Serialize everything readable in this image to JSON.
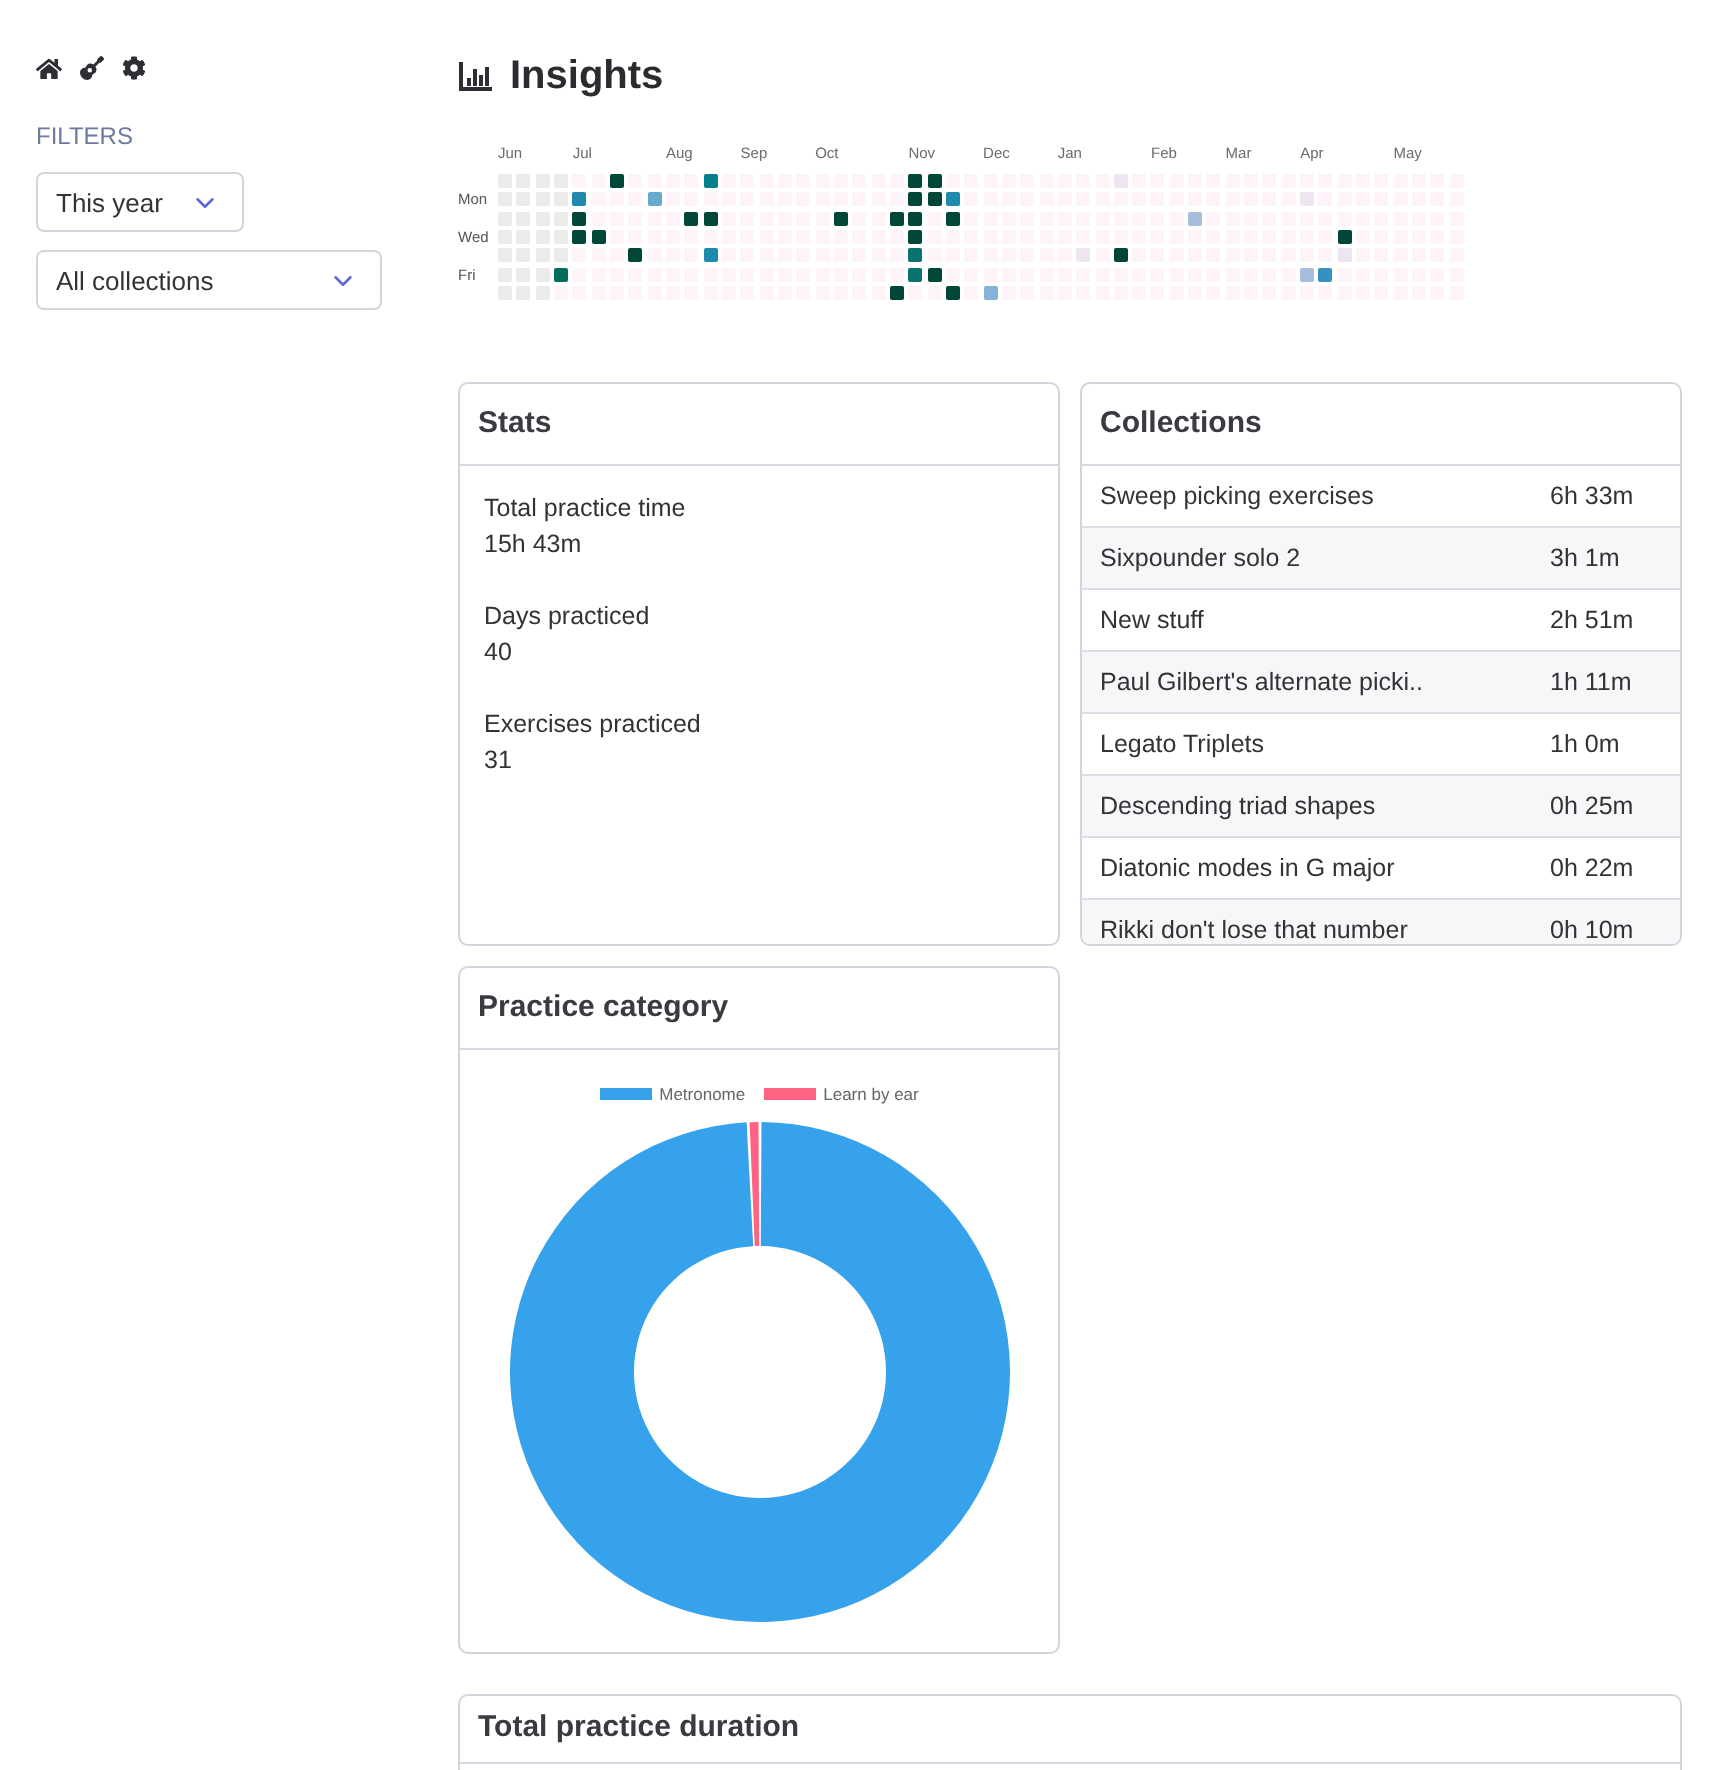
{
  "sidebar": {
    "filters_label": "FILTERS",
    "filters": [
      {
        "value": "This year"
      },
      {
        "value": "All collections"
      }
    ]
  },
  "page_title": "Insights",
  "heatmap": {
    "weekday_labels": [
      "Mon",
      "Wed",
      "Fri"
    ],
    "weeks": [
      {
        "month": "Jun",
        "days": [
          {
            "color": "#ebebeb"
          },
          {
            "color": "#ebebeb"
          },
          {
            "color": "#ebebeb"
          },
          {
            "color": "#ebebeb"
          },
          {
            "color": "#ebebeb"
          },
          {
            "color": "#ebebeb"
          },
          {
            "color": "#ebebeb"
          }
        ]
      },
      {
        "days": [
          {
            "color": "#ebebeb"
          },
          {
            "color": "#ebebeb"
          },
          {
            "color": "#ebebeb"
          },
          {
            "color": "#ebebeb"
          },
          {
            "color": "#ebebeb"
          },
          {
            "color": "#ebebeb"
          },
          {
            "color": "#ebebeb"
          }
        ]
      },
      {
        "days": [
          {
            "color": "#ebebeb"
          },
          {
            "color": "#ebebeb"
          },
          {
            "color": "#ebebeb"
          },
          {
            "color": "#ebebeb"
          },
          {
            "color": "#ebebeb"
          },
          {
            "color": "#ebebeb"
          },
          {
            "color": "#ebebeb"
          }
        ]
      },
      {
        "days": [
          {
            "color": "#ebebeb"
          },
          {
            "color": "#ebebeb"
          },
          {
            "color": "#ebebeb"
          },
          {
            "color": "#ebebeb"
          },
          {
            "color": "#ebebeb"
          },
          {
            "color": "#016c59"
          },
          {
            "color": "#fdf3f8"
          }
        ]
      },
      {
        "month": "Jul",
        "days": [
          {
            "color": "#fdf3f8"
          },
          {
            "color": "#1f8aab"
          },
          {
            "color": "#014636"
          },
          {
            "color": "#014636"
          },
          {
            "color": "#fdf3f8"
          },
          {
            "color": "#fdf3f8"
          },
          {
            "color": "#fdf3f8"
          }
        ]
      },
      {
        "days": [
          {
            "color": "#fdf3f8"
          },
          {
            "color": "#fdf3f8"
          },
          {
            "color": "#fdf3f8"
          },
          {
            "color": "#014636"
          },
          {
            "color": "#fdf3f8"
          },
          {
            "color": "#fdf3f8"
          },
          {
            "color": "#fdf3f8"
          }
        ]
      },
      {
        "days": [
          {
            "color": "#014636"
          },
          {
            "color": "#fdf3f8"
          },
          {
            "color": "#fdf3f8"
          },
          {
            "color": "#fdf3f8"
          },
          {
            "color": "#fdf3f8"
          },
          {
            "color": "#fdf3f8"
          },
          {
            "color": "#fdf3f8"
          }
        ]
      },
      {
        "days": [
          {
            "color": "#fdf3f8"
          },
          {
            "color": "#fdf3f8"
          },
          {
            "color": "#fdf3f8"
          },
          {
            "color": "#fdf3f8"
          },
          {
            "color": "#014636"
          },
          {
            "color": "#fdf3f8"
          },
          {
            "color": "#fdf3f8"
          }
        ]
      },
      {
        "days": [
          {
            "color": "#fdf3f8"
          },
          {
            "color": "#67a9cf"
          },
          {
            "color": "#fdf3f8"
          },
          {
            "color": "#fdf3f8"
          },
          {
            "color": "#fdf3f8"
          },
          {
            "color": "#fdf3f8"
          },
          {
            "color": "#fdf3f8"
          }
        ]
      },
      {
        "month": "Aug",
        "days": [
          {
            "color": "#fdf3f8"
          },
          {
            "color": "#fdf3f8"
          },
          {
            "color": "#fdf3f8"
          },
          {
            "color": "#fdf3f8"
          },
          {
            "color": "#fdf3f8"
          },
          {
            "color": "#fdf3f8"
          },
          {
            "color": "#fdf3f8"
          }
        ]
      },
      {
        "days": [
          {
            "color": "#fdf3f8"
          },
          {
            "color": "#fdf3f8"
          },
          {
            "color": "#014636"
          },
          {
            "color": "#fdf3f8"
          },
          {
            "color": "#fdf3f8"
          },
          {
            "color": "#fdf3f8"
          },
          {
            "color": "#fdf3f8"
          }
        ]
      },
      {
        "days": [
          {
            "color": "#02818a"
          },
          {
            "color": "#fdf3f8"
          },
          {
            "color": "#014636"
          },
          {
            "color": "#fdf3f8"
          },
          {
            "color": "#1f8aab"
          },
          {
            "color": "#fdf3f8"
          },
          {
            "color": "#fdf3f8"
          }
        ]
      },
      {
        "days": [
          {
            "color": "#fdf3f8"
          },
          {
            "color": "#fdf3f8"
          },
          {
            "color": "#fdf3f8"
          },
          {
            "color": "#fdf3f8"
          },
          {
            "color": "#fdf3f8"
          },
          {
            "color": "#fdf3f8"
          },
          {
            "color": "#fdf3f8"
          }
        ]
      },
      {
        "month": "Sep",
        "days": [
          {
            "color": "#fdf3f8"
          },
          {
            "color": "#fdf3f8"
          },
          {
            "color": "#fdf3f8"
          },
          {
            "color": "#fdf3f8"
          },
          {
            "color": "#fdf3f8"
          },
          {
            "color": "#fdf3f8"
          },
          {
            "color": "#fdf3f8"
          }
        ]
      },
      {
        "days": [
          {
            "color": "#fdf3f8"
          },
          {
            "color": "#fdf3f8"
          },
          {
            "color": "#fdf3f8"
          },
          {
            "color": "#fdf3f8"
          },
          {
            "color": "#fdf3f8"
          },
          {
            "color": "#fdf3f8"
          },
          {
            "color": "#fdf3f8"
          }
        ]
      },
      {
        "days": [
          {
            "color": "#fdf3f8"
          },
          {
            "color": "#fdf3f8"
          },
          {
            "color": "#fdf3f8"
          },
          {
            "color": "#fdf3f8"
          },
          {
            "color": "#fdf3f8"
          },
          {
            "color": "#fdf3f8"
          },
          {
            "color": "#fdf3f8"
          }
        ]
      },
      {
        "days": [
          {
            "color": "#fdf3f8"
          },
          {
            "color": "#fdf3f8"
          },
          {
            "color": "#fdf3f8"
          },
          {
            "color": "#fdf3f8"
          },
          {
            "color": "#fdf3f8"
          },
          {
            "color": "#fdf3f8"
          },
          {
            "color": "#fdf3f8"
          }
        ]
      },
      {
        "month": "Oct",
        "days": [
          {
            "color": "#fdf3f8"
          },
          {
            "color": "#fdf3f8"
          },
          {
            "color": "#fdf3f8"
          },
          {
            "color": "#fdf3f8"
          },
          {
            "color": "#fdf3f8"
          },
          {
            "color": "#fdf3f8"
          },
          {
            "color": "#fdf3f8"
          }
        ]
      },
      {
        "days": [
          {
            "color": "#fdf3f8"
          },
          {
            "color": "#fdf3f8"
          },
          {
            "color": "#014636"
          },
          {
            "color": "#fdf3f8"
          },
          {
            "color": "#fdf3f8"
          },
          {
            "color": "#fdf3f8"
          },
          {
            "color": "#fdf3f8"
          }
        ]
      },
      {
        "days": [
          {
            "color": "#fdf3f8"
          },
          {
            "color": "#fdf3f8"
          },
          {
            "color": "#fdf3f8"
          },
          {
            "color": "#fdf3f8"
          },
          {
            "color": "#fdf3f8"
          },
          {
            "color": "#fdf3f8"
          },
          {
            "color": "#fdf3f8"
          }
        ]
      },
      {
        "days": [
          {
            "color": "#fdf3f8"
          },
          {
            "color": "#fdf3f8"
          },
          {
            "color": "#fdf3f8"
          },
          {
            "color": "#fdf3f8"
          },
          {
            "color": "#fdf3f8"
          },
          {
            "color": "#fdf3f8"
          },
          {
            "color": "#fdf3f8"
          }
        ]
      },
      {
        "days": [
          {
            "color": "#fdf3f8"
          },
          {
            "color": "#fdf3f8"
          },
          {
            "color": "#014636"
          },
          {
            "color": "#fdf3f8"
          },
          {
            "color": "#fdf3f8"
          },
          {
            "color": "#fdf3f8"
          },
          {
            "color": "#014636"
          }
        ]
      },
      {
        "month": "Nov",
        "days": [
          {
            "color": "#014636"
          },
          {
            "color": "#014636"
          },
          {
            "color": "#014636"
          },
          {
            "color": "#014636"
          },
          {
            "color": "#0a7370"
          },
          {
            "color": "#0a7370"
          },
          {
            "color": "#fdf3f8"
          }
        ]
      },
      {
        "days": [
          {
            "color": "#014636"
          },
          {
            "color": "#014636"
          },
          {
            "color": "#fdf3f8"
          },
          {
            "color": "#fdf3f8"
          },
          {
            "color": "#fdf3f8"
          },
          {
            "color": "#014636"
          },
          {
            "color": "#fdf3f8"
          }
        ]
      },
      {
        "days": [
          {
            "color": "#fdf3f8"
          },
          {
            "color": "#1f8aab"
          },
          {
            "color": "#014636"
          },
          {
            "color": "#fdf3f8"
          },
          {
            "color": "#fdf3f8"
          },
          {
            "color": "#fdf3f8"
          },
          {
            "color": "#014636"
          }
        ]
      },
      {
        "days": [
          {
            "color": "#fdf3f8"
          },
          {
            "color": "#fdf3f8"
          },
          {
            "color": "#fdf3f8"
          },
          {
            "color": "#fdf3f8"
          },
          {
            "color": "#fdf3f8"
          },
          {
            "color": "#fdf3f8"
          },
          {
            "color": "#fdf3f8"
          }
        ]
      },
      {
        "month": "Dec",
        "days": [
          {
            "color": "#fdf3f8"
          },
          {
            "color": "#fdf3f8"
          },
          {
            "color": "#fdf3f8"
          },
          {
            "color": "#fdf3f8"
          },
          {
            "color": "#fdf3f8"
          },
          {
            "color": "#fdf3f8"
          },
          {
            "color": "#86b1d8"
          }
        ]
      },
      {
        "days": [
          {
            "color": "#fdf3f8"
          },
          {
            "color": "#fdf3f8"
          },
          {
            "color": "#fdf3f8"
          },
          {
            "color": "#fdf3f8"
          },
          {
            "color": "#fdf3f8"
          },
          {
            "color": "#fdf3f8"
          },
          {
            "color": "#fdf3f8"
          }
        ]
      },
      {
        "days": [
          {
            "color": "#fdf3f8"
          },
          {
            "color": "#fdf3f8"
          },
          {
            "color": "#fdf3f8"
          },
          {
            "color": "#fdf3f8"
          },
          {
            "color": "#fdf3f8"
          },
          {
            "color": "#fdf3f8"
          },
          {
            "color": "#fdf3f8"
          }
        ]
      },
      {
        "days": [
          {
            "color": "#fdf3f8"
          },
          {
            "color": "#fdf3f8"
          },
          {
            "color": "#fdf3f8"
          },
          {
            "color": "#fdf3f8"
          },
          {
            "color": "#fdf3f8"
          },
          {
            "color": "#fdf3f8"
          },
          {
            "color": "#fdf3f8"
          }
        ]
      },
      {
        "month": "Jan",
        "days": [
          {
            "color": "#fdf3f8"
          },
          {
            "color": "#fdf3f8"
          },
          {
            "color": "#fdf3f8"
          },
          {
            "color": "#fdf3f8"
          },
          {
            "color": "#fdf3f8"
          },
          {
            "color": "#fdf3f8"
          },
          {
            "color": "#fdf3f8"
          }
        ]
      },
      {
        "days": [
          {
            "color": "#fdf3f8"
          },
          {
            "color": "#fdf3f8"
          },
          {
            "color": "#fdf3f8"
          },
          {
            "color": "#fdf3f8"
          },
          {
            "color": "#efe5f1"
          },
          {
            "color": "#fdf3f8"
          },
          {
            "color": "#fdf3f8"
          }
        ]
      },
      {
        "days": [
          {
            "color": "#fdf3f8"
          },
          {
            "color": "#fdf3f8"
          },
          {
            "color": "#fdf3f8"
          },
          {
            "color": "#fdf3f8"
          },
          {
            "color": "#fdf3f8"
          },
          {
            "color": "#fdf3f8"
          },
          {
            "color": "#fdf3f8"
          }
        ]
      },
      {
        "days": [
          {
            "color": "#efe5f1"
          },
          {
            "color": "#fdf3f8"
          },
          {
            "color": "#fdf3f8"
          },
          {
            "color": "#fdf3f8"
          },
          {
            "color": "#014636"
          },
          {
            "color": "#fdf3f8"
          },
          {
            "color": "#fdf3f8"
          }
        ]
      },
      {
        "days": [
          {
            "color": "#fdf3f8"
          },
          {
            "color": "#fdf3f8"
          },
          {
            "color": "#fdf3f8"
          },
          {
            "color": "#fdf3f8"
          },
          {
            "color": "#fdf3f8"
          },
          {
            "color": "#fdf3f8"
          },
          {
            "color": "#fdf3f8"
          }
        ]
      },
      {
        "month": "Feb",
        "days": [
          {
            "color": "#fdf3f8"
          },
          {
            "color": "#fdf3f8"
          },
          {
            "color": "#fdf3f8"
          },
          {
            "color": "#fdf3f8"
          },
          {
            "color": "#fdf3f8"
          },
          {
            "color": "#fdf3f8"
          },
          {
            "color": "#fdf3f8"
          }
        ]
      },
      {
        "days": [
          {
            "color": "#fdf3f8"
          },
          {
            "color": "#fdf3f8"
          },
          {
            "color": "#fdf3f8"
          },
          {
            "color": "#fdf3f8"
          },
          {
            "color": "#fdf3f8"
          },
          {
            "color": "#fdf3f8"
          },
          {
            "color": "#fdf3f8"
          }
        ]
      },
      {
        "days": [
          {
            "color": "#fdf3f8"
          },
          {
            "color": "#fdf3f8"
          },
          {
            "color": "#a6bddb"
          },
          {
            "color": "#fdf3f8"
          },
          {
            "color": "#fdf3f8"
          },
          {
            "color": "#fdf3f8"
          },
          {
            "color": "#fdf3f8"
          }
        ]
      },
      {
        "days": [
          {
            "color": "#fdf3f8"
          },
          {
            "color": "#fdf3f8"
          },
          {
            "color": "#fdf3f8"
          },
          {
            "color": "#fdf3f8"
          },
          {
            "color": "#fdf3f8"
          },
          {
            "color": "#fdf3f8"
          },
          {
            "color": "#fdf3f8"
          }
        ]
      },
      {
        "month": "Mar",
        "days": [
          {
            "color": "#fdf3f8"
          },
          {
            "color": "#fdf3f8"
          },
          {
            "color": "#fdf3f8"
          },
          {
            "color": "#fdf3f8"
          },
          {
            "color": "#fdf3f8"
          },
          {
            "color": "#fdf3f8"
          },
          {
            "color": "#fdf3f8"
          }
        ]
      },
      {
        "days": [
          {
            "color": "#fdf3f8"
          },
          {
            "color": "#fdf3f8"
          },
          {
            "color": "#fdf3f8"
          },
          {
            "color": "#fdf3f8"
          },
          {
            "color": "#fdf3f8"
          },
          {
            "color": "#fdf3f8"
          },
          {
            "color": "#fdf3f8"
          }
        ]
      },
      {
        "days": [
          {
            "color": "#fdf3f8"
          },
          {
            "color": "#fdf3f8"
          },
          {
            "color": "#fdf3f8"
          },
          {
            "color": "#fdf3f8"
          },
          {
            "color": "#fdf3f8"
          },
          {
            "color": "#fdf3f8"
          },
          {
            "color": "#fdf3f8"
          }
        ]
      },
      {
        "days": [
          {
            "color": "#fdf3f8"
          },
          {
            "color": "#fdf3f8"
          },
          {
            "color": "#fdf3f8"
          },
          {
            "color": "#fdf3f8"
          },
          {
            "color": "#fdf3f8"
          },
          {
            "color": "#fdf3f8"
          },
          {
            "color": "#fdf3f8"
          }
        ]
      },
      {
        "month": "Apr",
        "days": [
          {
            "color": "#fdf3f8"
          },
          {
            "color": "#efe5f1"
          },
          {
            "color": "#fdf3f8"
          },
          {
            "color": "#fdf3f8"
          },
          {
            "color": "#fdf3f8"
          },
          {
            "color": "#a6bddb"
          },
          {
            "color": "#fdf3f8"
          }
        ]
      },
      {
        "days": [
          {
            "color": "#fdf3f8"
          },
          {
            "color": "#fdf3f8"
          },
          {
            "color": "#fdf3f8"
          },
          {
            "color": "#fdf3f8"
          },
          {
            "color": "#fdf3f8"
          },
          {
            "color": "#3690c0"
          },
          {
            "color": "#fdf3f8"
          }
        ]
      },
      {
        "days": [
          {
            "color": "#fdf3f8"
          },
          {
            "color": "#fdf3f8"
          },
          {
            "color": "#fdf3f8"
          },
          {
            "color": "#014636"
          },
          {
            "color": "#efe5f1"
          },
          {
            "color": "#fdf3f8"
          },
          {
            "color": "#fdf3f8"
          }
        ]
      },
      {
        "days": [
          {
            "color": "#fdf3f8"
          },
          {
            "color": "#fdf3f8"
          },
          {
            "color": "#fdf3f8"
          },
          {
            "color": "#fdf3f8"
          },
          {
            "color": "#fdf3f8"
          },
          {
            "color": "#fdf3f8"
          },
          {
            "color": "#fdf3f8"
          }
        ]
      },
      {
        "days": [
          {
            "color": "#fdf3f8"
          },
          {
            "color": "#fdf3f8"
          },
          {
            "color": "#fdf3f8"
          },
          {
            "color": "#fdf3f8"
          },
          {
            "color": "#fdf3f8"
          },
          {
            "color": "#fdf3f8"
          },
          {
            "color": "#fdf3f8"
          }
        ]
      },
      {
        "month": "May",
        "days": [
          {
            "color": "#fdf3f8"
          },
          {
            "color": "#fdf3f8"
          },
          {
            "color": "#fdf3f8"
          },
          {
            "color": "#fdf3f8"
          },
          {
            "color": "#fdf3f8"
          },
          {
            "color": "#fdf3f8"
          },
          {
            "color": "#fdf3f8"
          }
        ]
      },
      {
        "days": [
          {
            "color": "#fdf3f8"
          },
          {
            "color": "#fdf3f8"
          },
          {
            "color": "#fdf3f8"
          },
          {
            "color": "#fdf3f8"
          },
          {
            "color": "#fdf3f8"
          },
          {
            "color": "#fdf3f8"
          },
          {
            "color": "#fdf3f8"
          }
        ]
      },
      {
        "days": [
          {
            "color": "#fdf3f8"
          },
          {
            "color": "#fdf3f8"
          },
          {
            "color": "#fdf3f8"
          },
          {
            "color": "#fdf3f8"
          },
          {
            "color": "#fdf3f8"
          },
          {
            "color": "#fdf3f8"
          },
          {
            "color": "#fdf3f8"
          }
        ]
      },
      {
        "days": [
          {
            "color": "#fdf3f8"
          },
          {
            "color": "#fdf3f8"
          },
          {
            "color": "#fdf3f8"
          },
          {
            "color": "#fdf3f8"
          },
          {
            "color": "#fdf3f8"
          },
          {
            "color": "#fdf3f8"
          },
          {
            "color": "#fdf3f8"
          }
        ]
      }
    ]
  },
  "stats": {
    "title": "Stats",
    "items": [
      {
        "label": "Total practice time",
        "value": "15h 43m"
      },
      {
        "label": "Days practiced",
        "value": "40"
      },
      {
        "label": "Exercises practiced",
        "value": "31"
      }
    ]
  },
  "collections": {
    "title": "Collections",
    "rows": [
      {
        "name": "Sweep picking exercises",
        "duration": "6h 33m"
      },
      {
        "name": "Sixpounder solo 2",
        "duration": "3h 1m"
      },
      {
        "name": "New stuff",
        "duration": "2h 51m"
      },
      {
        "name": "Paul Gilbert's alternate picki..",
        "duration": "1h 11m"
      },
      {
        "name": "Legato Triplets",
        "duration": "1h 0m"
      },
      {
        "name": "Descending triad shapes",
        "duration": "0h 25m"
      },
      {
        "name": "Diatonic modes in G major",
        "duration": "0h 22m"
      },
      {
        "name": "Rikki don't lose that number",
        "duration": "0h 10m"
      }
    ]
  },
  "practice_category": {
    "title": "Practice category",
    "legend": [
      {
        "label": "Metronome",
        "color": "#36a2eb"
      },
      {
        "label": "Learn by ear",
        "color": "#ff6384"
      }
    ]
  },
  "total_practice_duration": {
    "title": "Total practice duration"
  }
}
